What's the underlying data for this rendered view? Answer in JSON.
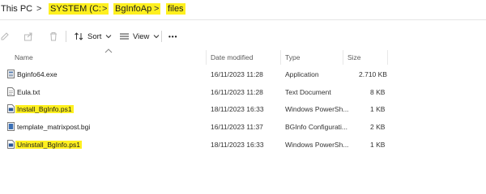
{
  "breadcrumb": {
    "items": [
      "This PC",
      "SYSTEM (C:)",
      "BgInfoApp",
      "files"
    ],
    "separator": ">"
  },
  "toolbar": {
    "sort_label": "Sort",
    "view_label": "View",
    "more_label": "•••"
  },
  "columns": [
    "Name",
    "Date modified",
    "Type",
    "Size"
  ],
  "files": [
    {
      "name": "Bginfo64.exe",
      "date": "16/11/2023 11:28",
      "type": "Application",
      "size": "2.710 KB",
      "icon": "exe-icon",
      "highlighted": false
    },
    {
      "name": "Eula.txt",
      "date": "16/11/2023 11:28",
      "type": "Text Document",
      "size": "8 KB",
      "icon": "text-file-icon",
      "highlighted": false
    },
    {
      "name": "Install_BgInfo.ps1",
      "date": "18/11/2023 16:33",
      "type": "Windows PowerSh...",
      "size": "1 KB",
      "icon": "powershell-file-icon",
      "highlighted": true
    },
    {
      "name": "template_matrixpost.bgi",
      "date": "16/11/2023 11:37",
      "type": "BGInfo Configurati...",
      "size": "2 KB",
      "icon": "bgi-file-icon",
      "highlighted": false
    },
    {
      "name": "Uninstall_BgInfo.ps1",
      "date": "18/11/2023 16:33",
      "type": "Windows PowerSh...",
      "size": "1 KB",
      "icon": "powershell-file-icon",
      "highlighted": true
    }
  ],
  "colors": {
    "highlight": "#fff01f",
    "accent": "#0067c0"
  }
}
